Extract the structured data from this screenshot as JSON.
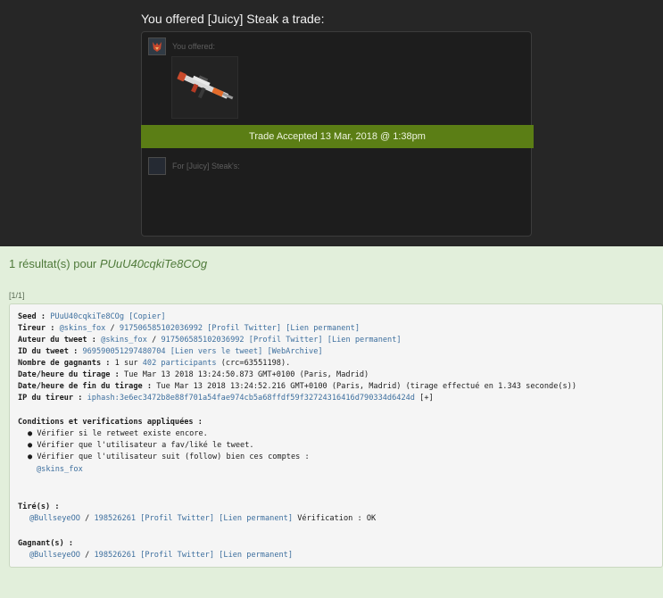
{
  "trade": {
    "title": "You offered [Juicy] Steak a trade:",
    "you_offered_label": "You offered:",
    "status": "Trade Accepted 13 Mar, 2018 @ 1:38pm",
    "for_label": "For [Juicy] Steak's:"
  },
  "results": {
    "count_text": "1 résultat(s) pour ",
    "seed_value": "PUuU40cqkiTe8COg",
    "page_indicator": "[1/1]"
  },
  "details": {
    "seed": {
      "label": "Seed :",
      "value": "PUuU40cqkiTe8COg",
      "copy": "[Copier]"
    },
    "tireur": {
      "label": "Tireur :",
      "handle": "@skins_fox",
      "sep": "/",
      "id": "917506585102036992",
      "profile": "[Profil Twitter]",
      "permalink": "[Lien permanent]"
    },
    "auteur": {
      "label": "Auteur du tweet :",
      "handle": "@skins_fox",
      "sep": "/",
      "id": "917506585102036992",
      "profile": "[Profil Twitter]",
      "permalink": "[Lien permanent]"
    },
    "tweet": {
      "label": "ID du tweet :",
      "id": "969590051297480704",
      "link": "[Lien vers le tweet]",
      "archive": "[WebArchive]"
    },
    "gagnants": {
      "label": "Nombre de gagnants :",
      "text_before": "1 sur",
      "participants": "402 participants",
      "text_after": "(crc=63551198)."
    },
    "tirage": {
      "label": "Date/heure du tirage :",
      "value": "Tue Mar 13 2018 13:24:50.873 GMT+0100 (Paris, Madrid)"
    },
    "fin": {
      "label": "Date/heure de fin du tirage :",
      "value": "Tue Mar 13 2018 13:24:52.216 GMT+0100 (Paris, Madrid) (tirage effectué en 1.343 seconde(s))"
    },
    "ip": {
      "label": "IP du tireur :",
      "value": "iphash:3e6ec3472b8e88f701a54fae974cb5a68ffdf59f32724316416d790334d6424d",
      "plus": "[+]"
    },
    "conditions": {
      "label": "Conditions et verifications appliquées :",
      "items": [
        "Vérifier si le retweet existe encore.",
        "Vérifier que l'utilisateur a fav/liké le tweet.",
        "Vérifier que l'utilisateur suit (follow) bien ces comptes :"
      ],
      "accounts": [
        "@skins_fox"
      ]
    },
    "tires": {
      "label": "Tiré(s) :",
      "handle": "@BullseyeOO",
      "sep": "/",
      "id": "198526261",
      "profile": "[Profil Twitter]",
      "permalink": "[Lien permanent]",
      "verification": "Vérification : OK"
    },
    "winners": {
      "label": "Gagnant(s) :",
      "handle": "@BullseyeOO",
      "sep": "/",
      "id": "198526261",
      "profile": "[Profil Twitter]",
      "permalink": "[Lien permanent]"
    }
  },
  "colors": {
    "accepted_bar": "#5b7e15",
    "link": "#3d6f9e",
    "page_bg": "#e2efdb",
    "dark_bg": "#262626"
  },
  "icons": {
    "weapon": "rifle-skin-icon",
    "avatar": "user-avatar-icon"
  }
}
